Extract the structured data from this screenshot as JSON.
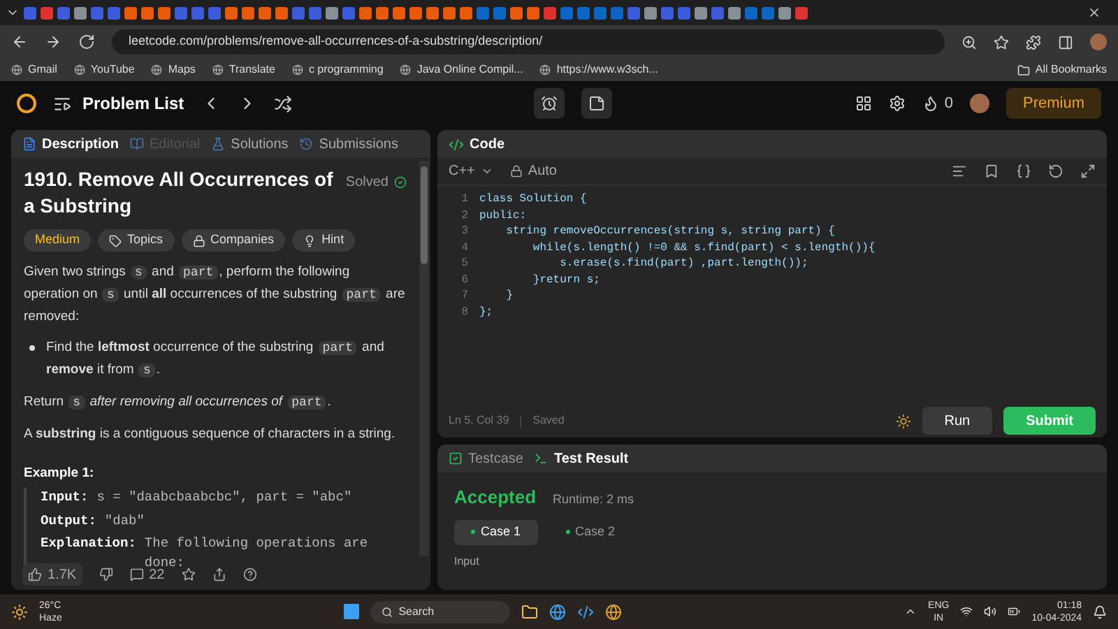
{
  "browser": {
    "url": "leetcode.com/problems/remove-all-occurrences-of-a-substring/description/",
    "bookmarks": [
      "Gmail",
      "YouTube",
      "Maps",
      "Translate",
      "c programming",
      "Java Online Compil...",
      "https://www.w3sch..."
    ],
    "all_bookmarks": "All Bookmarks"
  },
  "header": {
    "title": "Problem List",
    "streak": "0",
    "premium": "Premium"
  },
  "left_tabs": [
    {
      "label": "Description",
      "selected": true,
      "disabled": false
    },
    {
      "label": "Editorial",
      "selected": false,
      "disabled": true
    },
    {
      "label": "Solutions",
      "selected": false,
      "disabled": false
    },
    {
      "label": "Submissions",
      "selected": false,
      "disabled": false
    }
  ],
  "problem": {
    "title": "1910. Remove All Occurrences of a Substring",
    "status": "Solved",
    "tags": [
      {
        "kind": "difficulty",
        "label": "Medium"
      },
      {
        "kind": "topics",
        "label": "Topics"
      },
      {
        "kind": "companies",
        "label": "Companies"
      },
      {
        "kind": "hint",
        "label": "Hint"
      }
    ],
    "paragraphs": [
      {
        "kind": "text",
        "parts": [
          {
            "kind": "text",
            "text": "Given two strings "
          },
          {
            "kind": "code",
            "text": "s"
          },
          {
            "kind": "text",
            "text": " and "
          },
          {
            "kind": "code",
            "text": "part"
          },
          {
            "kind": "text",
            "text": ", perform the following operation on "
          },
          {
            "kind": "code",
            "text": "s"
          },
          {
            "kind": "text",
            "text": " until **all** occurrences of the substring "
          },
          {
            "kind": "code",
            "text": "part"
          },
          {
            "kind": "text",
            "text": " are removed:"
          }
        ]
      },
      {
        "kind": "bullet",
        "parts": [
          {
            "kind": "text",
            "text": "Find the **leftmost** occurrence of the substring "
          },
          {
            "kind": "code",
            "text": "part"
          },
          {
            "kind": "text",
            "text": " and **remove** it from "
          },
          {
            "kind": "code",
            "text": "s"
          },
          {
            "kind": "text",
            "text": "."
          }
        ]
      },
      {
        "kind": "text",
        "parts": [
          {
            "kind": "text",
            "text": "Return "
          },
          {
            "kind": "code",
            "text": "s"
          },
          {
            "kind": "text",
            "text": " *after removing all occurrences of* "
          },
          {
            "kind": "code",
            "text": "part"
          },
          {
            "kind": "text",
            "text": "."
          }
        ]
      },
      {
        "kind": "text",
        "parts": [
          {
            "kind": "text",
            "text": "A **substring** is a contiguous sequence of characters in a string."
          }
        ]
      }
    ],
    "example_title": "Example 1:",
    "example_lines": [
      {
        "label": "Input:",
        "text": "s = \"daabcbaabcbc\", part = \"abc\""
      },
      {
        "label": "Output:",
        "text": "\"dab\""
      },
      {
        "label": "Explanation:",
        "text": "The following operations are done:"
      }
    ],
    "likes": "1.7K",
    "comments": "22"
  },
  "code": {
    "title": "Code",
    "language": "C++",
    "mode": "Auto",
    "lines": [
      "class Solution {",
      "public:",
      "    string removeOccurrences(string s, string part) {",
      "        while(s.length() !=0 && s.find(part) < s.length()){",
      "            s.erase(s.find(part) ,part.length());",
      "        }return s;",
      "    }",
      "};"
    ],
    "line_numbers": [
      "1",
      "2",
      "3",
      "4",
      "5",
      "6",
      "7",
      "8"
    ],
    "cursor": "Ln 5, Col 39",
    "saved": "Saved",
    "run": "Run",
    "submit": "Submit"
  },
  "result_tabs": [
    {
      "label": "Testcase",
      "selected": false
    },
    {
      "label": "Test Result",
      "selected": true
    }
  ],
  "result": {
    "verdict": "Accepted",
    "runtime": "Runtime: 2 ms",
    "cases": [
      {
        "label": "Case 1",
        "selected": true
      },
      {
        "label": "Case 2",
        "selected": false
      }
    ],
    "input_label": "Input"
  },
  "taskbar": {
    "temp": "26°C",
    "weather": "Haze",
    "search": "Search",
    "lang": "ENG",
    "region": "IN",
    "time": "01:18",
    "date": "10-04-2024"
  }
}
